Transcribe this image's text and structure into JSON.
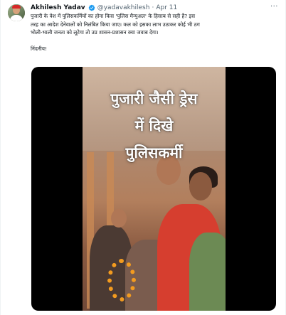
{
  "author": {
    "name": "Akhilesh Yadav",
    "handle": "@yadavakhilesh",
    "separator": "·",
    "date": "Apr 11",
    "verified_icon": "verified-badge-icon"
  },
  "more_label": "···",
  "tweet": {
    "line1": "पुजारी के वेश में पुलिसकर्मियों का होना किस 'पुलिस मैन्युअल' के हिसाब से सही है? इस",
    "line2": "तरह का आदेश देनेवालों को निलंबित किया जाए। कल को इसका लाभ उठाकर कोई भी ठग",
    "line3": "भोली-भाली जनता को लूटेगा तो उप्र शासन-प्रशासन क्या जवाब देगा।",
    "closing": "निंदनीय!"
  },
  "video_caption": {
    "line1": "पुजारी जैसी ड्रेस",
    "line2": "में दिखे",
    "line3": "पुलिसकर्मी"
  },
  "colors": {
    "verified": "#1d9bf0",
    "secondary_text": "#536471",
    "media_bg": "#000000"
  }
}
